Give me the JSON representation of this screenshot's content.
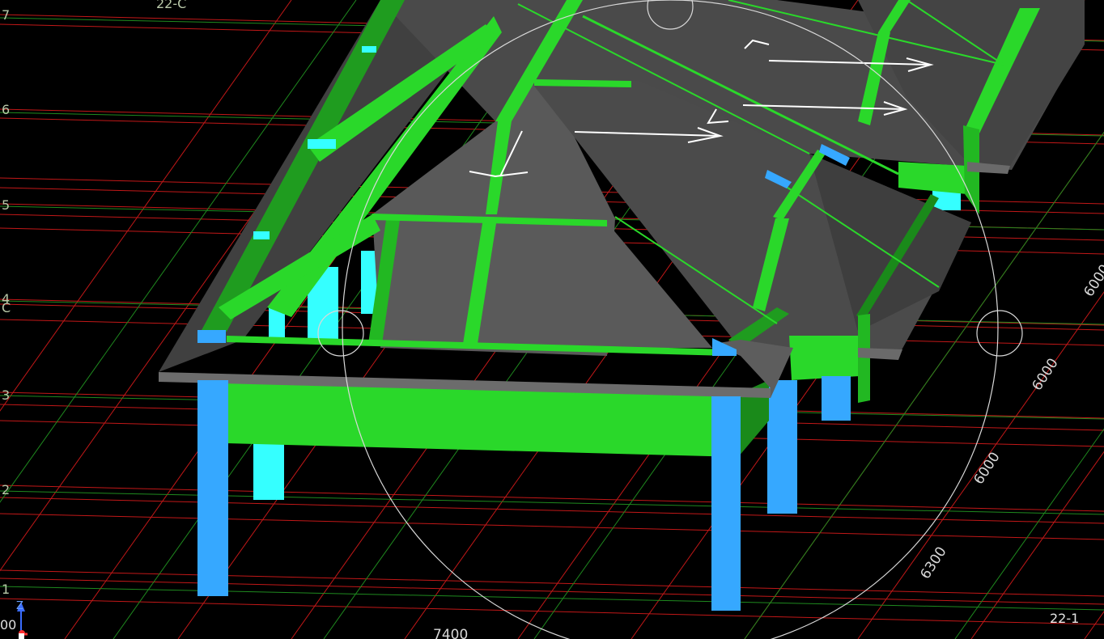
{
  "viewport": {
    "background": "#000000",
    "grid_colors": {
      "primary": "#c21818",
      "secondary": "#1f8a1f"
    },
    "member_colors": {
      "beam": "#2ad82a",
      "beam_dark": "#1a8a1a",
      "column": "#36a8ff",
      "column_cyan": "#35ffff",
      "roof_slab": "#585858",
      "roof_slab_dark": "#3c3c3c",
      "slab_edge": "#6c6c6c"
    }
  },
  "grid_labels": {
    "row_7": "7",
    "row_6": "6",
    "row_5": "5",
    "row_4": "4",
    "row_c": "C",
    "row_3": "3",
    "row_2": "2",
    "row_1": "1",
    "top_axis": "22-C",
    "bottom_right_axis": "22-1"
  },
  "dimensions": {
    "d1": "6000",
    "d2": "6000",
    "d3": "6000",
    "d4": "6300",
    "d5": "7400"
  },
  "axis_gizmo": {
    "z_label": "Z",
    "origin_text": "00",
    "icon": "axis-triad-icon"
  },
  "navigation": {
    "orbit_ring": "orbit-ring-icon"
  }
}
